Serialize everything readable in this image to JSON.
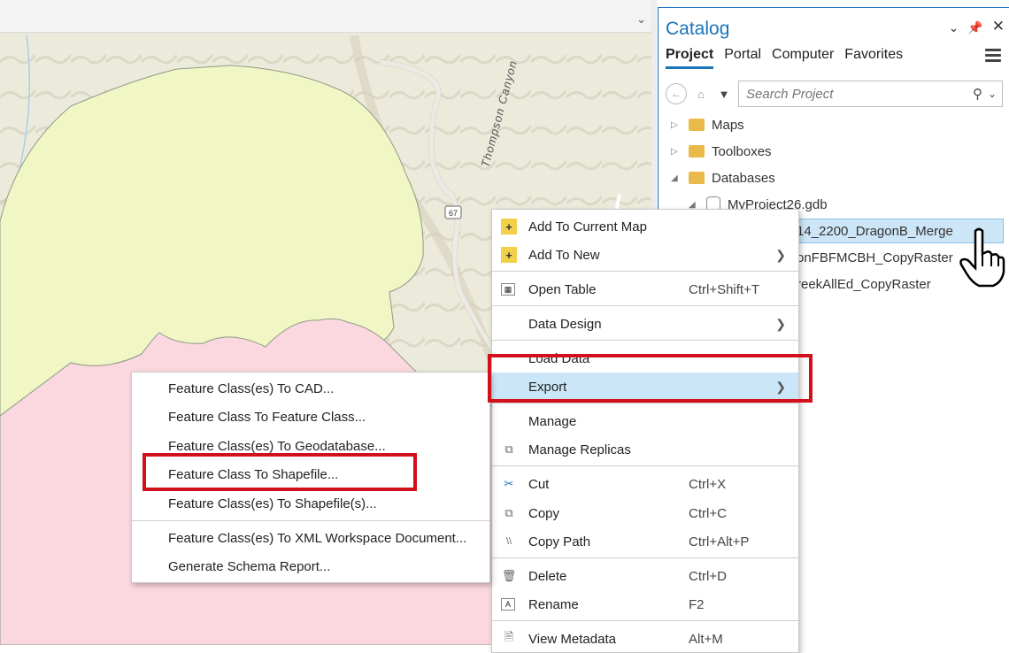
{
  "map": {
    "canyon_label": "Thompson Canyon",
    "route_shield": "67"
  },
  "catalog": {
    "title": "Catalog",
    "tabs": [
      "Project",
      "Portal",
      "Computer",
      "Favorites"
    ],
    "search_placeholder": "Search Project",
    "tree": {
      "maps": "Maps",
      "toolboxes": "Toolboxes",
      "databases": "Databases",
      "gdb": "MyProject26.gdb",
      "item1": "14_2200_DragonB_Merge",
      "item2": "onFBFMCBH_CopyRaster",
      "item3": "reekAllEd_CopyRaster"
    }
  },
  "context_menu": {
    "add_to_current_map": "Add To Current Map",
    "add_to_new": "Add To New",
    "open_table": "Open Table",
    "open_table_shortcut": "Ctrl+Shift+T",
    "data_design": "Data Design",
    "load_data": "Load Data",
    "export": "Export",
    "manage": "Manage",
    "manage_replicas": "Manage Replicas",
    "cut": "Cut",
    "cut_shortcut": "Ctrl+X",
    "copy": "Copy",
    "copy_shortcut": "Ctrl+C",
    "copy_path": "Copy Path",
    "copy_path_shortcut": "Ctrl+Alt+P",
    "delete": "Delete",
    "delete_shortcut": "Ctrl+D",
    "rename": "Rename",
    "rename_shortcut": "F2",
    "view_metadata": "View Metadata",
    "view_metadata_shortcut": "Alt+M"
  },
  "export_submenu": {
    "to_cad": "Feature Class(es) To CAD...",
    "to_feature_class": "Feature Class To Feature Class...",
    "to_geodatabase": "Feature Class(es) To Geodatabase...",
    "to_shapefile": "Feature Class To Shapefile...",
    "to_shapefiles": "Feature Class(es) To Shapefile(s)...",
    "to_xml": "Feature Class(es) To XML Workspace Document...",
    "schema_report": "Generate Schema Report..."
  },
  "colors": {
    "accent": "#1b73b8",
    "highlight": "#cbe6f8",
    "annotation_red": "#d2101b",
    "map_yellow": "#f1f7c4",
    "map_pink": "#fbd8df"
  }
}
